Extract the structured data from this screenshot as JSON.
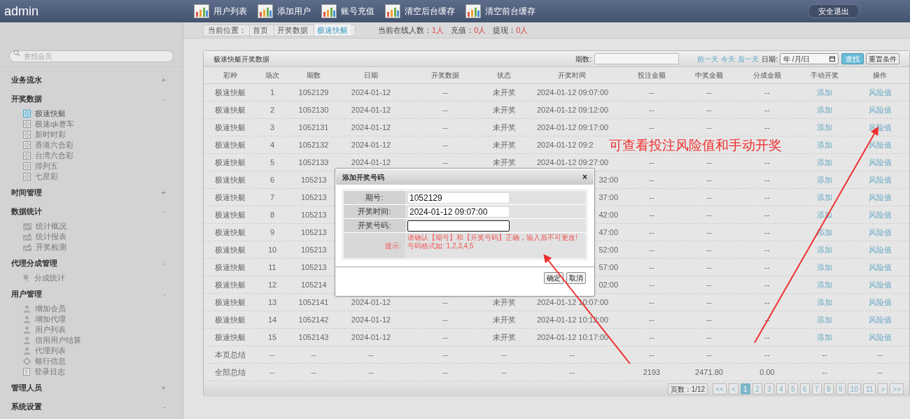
{
  "header": {
    "brand": "admin",
    "nav": [
      {
        "label": "用户列表"
      },
      {
        "label": "添加用户"
      },
      {
        "label": "账号充值"
      },
      {
        "label": "清空后台缓存"
      },
      {
        "label": "清空前台缓存"
      }
    ],
    "logout": "安全退出"
  },
  "breadcrumb": {
    "prefix": "当前位置：",
    "items": [
      {
        "label": "首页",
        "selected": false
      },
      {
        "label": "开奖数据",
        "selected": false
      },
      {
        "label": "极速快艇",
        "selected": true
      }
    ]
  },
  "stats": [
    {
      "label": "当前在线人数：",
      "value": "1人"
    },
    {
      "label": "充值：",
      "value": "0人"
    },
    {
      "label": "提现：",
      "value": "0人"
    }
  ],
  "sidebar": {
    "search_placeholder": "查找会员",
    "sections": [
      {
        "title": "业务流水",
        "toggle": "+"
      },
      {
        "title": "开奖数据",
        "toggle": "-",
        "children": [
          {
            "label": "极速快艇",
            "kind": "lottery",
            "selected": true
          },
          {
            "label": "极速qk赛车",
            "kind": "lottery",
            "selected": false
          },
          {
            "label": "新时时彩",
            "kind": "lottery",
            "selected": false
          },
          {
            "label": "香港六合彩",
            "kind": "lottery",
            "selected": false
          },
          {
            "label": "台湾六合彩",
            "kind": "lottery",
            "selected": false
          },
          {
            "label": "排列五",
            "kind": "lottery",
            "selected": false
          },
          {
            "label": "七星彩",
            "kind": "lottery",
            "selected": false
          }
        ]
      },
      {
        "title": "时间管理",
        "toggle": "+"
      },
      {
        "title": "数据统计",
        "toggle": "-",
        "children": [
          {
            "label": "统计概况",
            "kind": "chart",
            "selected": false
          },
          {
            "label": "统计报表",
            "kind": "report",
            "selected": false
          },
          {
            "label": "开奖检测",
            "kind": "report",
            "selected": false
          }
        ]
      },
      {
        "title": "代理分成管理",
        "toggle": "-",
        "children": [
          {
            "label": "分成统计",
            "kind": "pin",
            "selected": false
          }
        ]
      },
      {
        "title": "用户管理",
        "toggle": "-",
        "children": [
          {
            "label": "增加会员",
            "kind": "user",
            "selected": false
          },
          {
            "label": "增加代理",
            "kind": "user",
            "selected": false
          },
          {
            "label": "用户列表",
            "kind": "user",
            "selected": false
          },
          {
            "label": "信用用户结算",
            "kind": "user",
            "selected": false
          },
          {
            "label": "代理列表",
            "kind": "user",
            "selected": false
          },
          {
            "label": "银行信息",
            "kind": "bank",
            "selected": false
          },
          {
            "label": "登录日志",
            "kind": "log",
            "selected": false
          }
        ]
      },
      {
        "title": "管理人员",
        "toggle": "+"
      },
      {
        "title": "系统设置",
        "toggle": "-"
      }
    ]
  },
  "panel": {
    "title": "极速快艇开奖数据",
    "issue_label": "期数:",
    "day_links": [
      "前一天",
      "今天",
      "后一天"
    ],
    "date_label": "日期:",
    "date_placeholder": "年 /月/日",
    "search": "查找",
    "reset": "重置条件"
  },
  "table": {
    "columns": [
      "彩种",
      "场次",
      "期数",
      "日期",
      "开奖数据",
      "状态",
      "开奖时间",
      "投注金额",
      "中奖金额",
      "分成金额",
      "手动开奖",
      "操作"
    ],
    "rows": [
      {
        "covered": false,
        "cells": [
          "极速快艇",
          "1",
          "1052129",
          "2024-01-12",
          "--",
          "未开奖",
          "2024-01-12 09:07:00",
          "--",
          "--",
          "--",
          "添加",
          "风险值"
        ]
      },
      {
        "covered": false,
        "cells": [
          "极速快艇",
          "2",
          "1052130",
          "2024-01-12",
          "--",
          "未开奖",
          "2024-01-12 09:12:00",
          "--",
          "--",
          "--",
          "添加",
          "风险值"
        ]
      },
      {
        "covered": false,
        "cells": [
          "极速快艇",
          "3",
          "1052131",
          "2024-01-12",
          "--",
          "未开奖",
          "2024-01-12 09:17:00",
          "--",
          "--",
          "--",
          "添加",
          "风险值"
        ]
      },
      {
        "covered": false,
        "cells": [
          "极速快艇",
          "4",
          "1052132",
          "2024-01-12",
          "--",
          "未开奖",
          "2024-01-12 09:2",
          null,
          null,
          null,
          "添加",
          "风险值"
        ]
      },
      {
        "covered": false,
        "cells": [
          "极速快艇",
          "5",
          "1052133",
          "2024-01-12",
          "--",
          "未开奖",
          "2024-01-12 09:27:00",
          "--",
          "--",
          "--",
          "添加",
          "风险值"
        ]
      },
      {
        "covered": true,
        "cells": [
          "极速快艇",
          "6",
          "105213",
          null,
          null,
          null,
          "32:00",
          "--",
          "--",
          "--",
          "添加",
          "风险值"
        ]
      },
      {
        "covered": true,
        "cells": [
          "极速快艇",
          "7",
          "105213",
          null,
          null,
          null,
          "37:00",
          "--",
          "--",
          "--",
          "添加",
          "风险值"
        ]
      },
      {
        "covered": true,
        "cells": [
          "极速快艇",
          "8",
          "105213",
          null,
          null,
          null,
          "42:00",
          "--",
          "--",
          "--",
          "添加",
          "风险值"
        ]
      },
      {
        "covered": true,
        "cells": [
          "极速快艇",
          "9",
          "105213",
          null,
          null,
          null,
          "47:00",
          "--",
          "--",
          "--",
          "添加",
          "风险值"
        ]
      },
      {
        "covered": true,
        "cells": [
          "极速快艇",
          "10",
          "105213",
          null,
          null,
          null,
          "52:00",
          "--",
          "--",
          "--",
          "添加",
          "风险值"
        ]
      },
      {
        "covered": true,
        "cells": [
          "极速快艇",
          "11",
          "105213",
          null,
          null,
          null,
          "57:00",
          "--",
          "--",
          "--",
          "添加",
          "风险值"
        ]
      },
      {
        "covered": true,
        "cells": [
          "极速快艇",
          "12",
          "105214",
          null,
          null,
          null,
          "02:00",
          "--",
          "--",
          "--",
          "添加",
          "风险值"
        ]
      },
      {
        "covered": false,
        "cells": [
          "极速快艇",
          "13",
          "1052141",
          "2024-01-12",
          "--",
          "未开奖",
          "2024-01-12 10:07:00",
          "--",
          "--",
          "--",
          "添加",
          "风险值"
        ]
      },
      {
        "covered": false,
        "cells": [
          "极速快艇",
          "14",
          "1052142",
          "2024-01-12",
          "--",
          "未开奖",
          "2024-01-12 10:12:00",
          "--",
          "--",
          "--",
          "添加",
          "风险值"
        ]
      },
      {
        "covered": false,
        "cells": [
          "极速快艇",
          "15",
          "1052143",
          "2024-01-12",
          "--",
          "未开奖",
          "2024-01-12 10:17:00",
          "--",
          "--",
          "--",
          "添加",
          "风险值"
        ]
      }
    ],
    "totals": [
      {
        "cells": [
          "本页总结",
          "--",
          "--",
          "--",
          "--",
          "--",
          "--",
          "--",
          "--",
          "--",
          "--",
          "--"
        ]
      },
      {
        "cells": [
          "全部总结",
          "--",
          "--",
          "--",
          "--",
          "--",
          "--",
          "2193",
          "2471.80",
          "0.00",
          "--",
          "--"
        ]
      }
    ]
  },
  "pagination": {
    "info": "页数：1/12",
    "pages": [
      {
        "label": "<<",
        "selected": false
      },
      {
        "label": "<",
        "selected": false
      },
      {
        "label": "1",
        "selected": true
      },
      {
        "label": "2",
        "selected": false
      },
      {
        "label": "3",
        "selected": false
      },
      {
        "label": "4",
        "selected": false
      },
      {
        "label": "5",
        "selected": false
      },
      {
        "label": "6",
        "selected": false
      },
      {
        "label": "7",
        "selected": false
      },
      {
        "label": "8",
        "selected": false
      },
      {
        "label": "9",
        "selected": false
      },
      {
        "label": "10",
        "selected": false
      },
      {
        "label": "11",
        "selected": false
      },
      {
        "label": ">",
        "selected": false
      },
      {
        "label": ">>",
        "selected": false
      }
    ]
  },
  "dialog": {
    "title": "添加开奖号码",
    "close": "×",
    "fields": [
      {
        "label": "期号:",
        "value": "1052129"
      },
      {
        "label": "开奖时间:",
        "value": "2024-01-12 09:07:00"
      },
      {
        "label": "开奖号码:"
      }
    ],
    "hint_label": "提示:",
    "hint_lines": [
      "请确认【期号】和【开奖号码】正确，输入后不可更改!",
      "号码格式如: 1,2,3,4,5"
    ],
    "buttons": [
      "确定",
      "取消"
    ]
  },
  "annotation": {
    "text": "可查看投注风险值和手动开奖"
  }
}
